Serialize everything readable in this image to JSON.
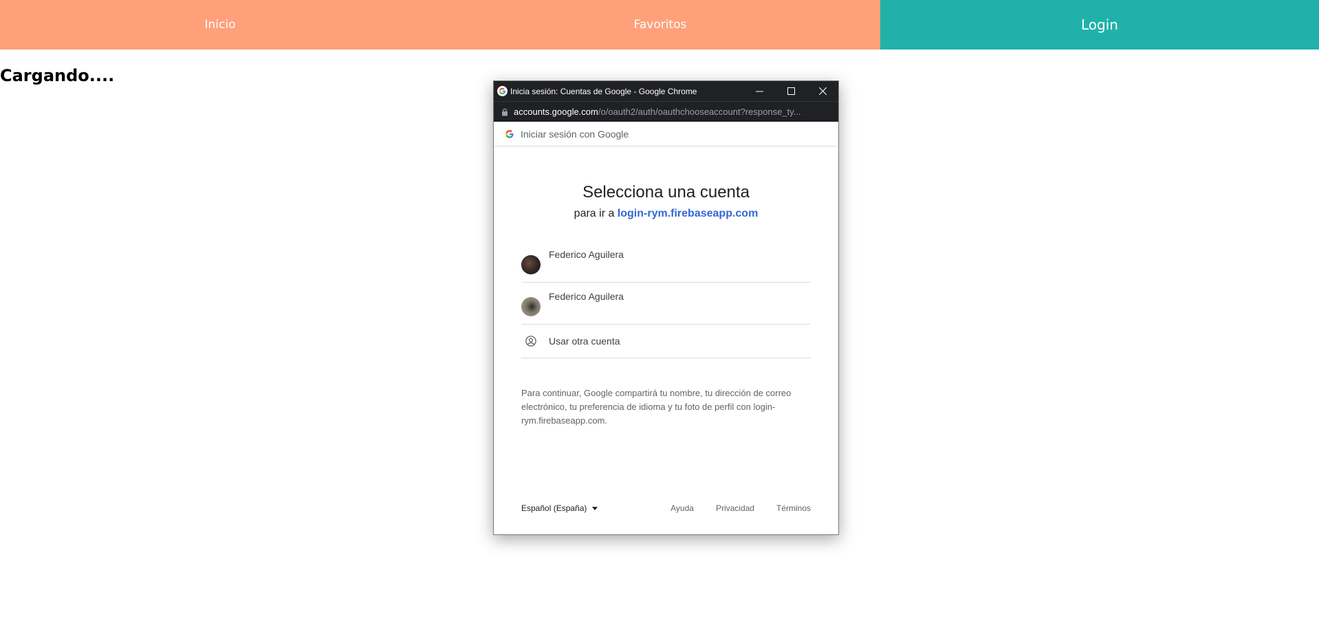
{
  "nav": {
    "items": [
      {
        "label": "Inicio"
      },
      {
        "label": "Favoritos"
      },
      {
        "label": "Login"
      }
    ]
  },
  "main": {
    "loading_text": "Cargando...."
  },
  "popup": {
    "window_title": "Inicia sesión: Cuentas de Google - Google Chrome",
    "url_host": "accounts.google.com",
    "url_path": "/o/oauth2/auth/oauthchooseaccount?response_ty...",
    "signin_header": "Iniciar sesión con Google",
    "heading": "Selecciona una cuenta",
    "subheading_prefix": "para ir a ",
    "subheading_link": "login-rym.firebaseapp.com",
    "accounts": [
      {
        "name": "Federico Aguilera"
      },
      {
        "name": "Federico Aguilera"
      }
    ],
    "other_account_label": "Usar otra cuenta",
    "disclaimer": "Para continuar, Google compartirá tu nombre, tu dirección de correo electrónico, tu preferencia de idioma y tu foto de perfil con login-rym.firebaseapp.com.",
    "footer": {
      "language": "Español (España)",
      "links": [
        "Ayuda",
        "Privacidad",
        "Términos"
      ]
    }
  },
  "colors": {
    "nav_coral": "#ffa07a",
    "nav_teal": "#20b2aa",
    "chrome_dark": "#202124",
    "link_blue": "#3367d6"
  },
  "icons": [
    "google-favicon",
    "minimize-icon",
    "maximize-icon",
    "close-icon",
    "lock-icon",
    "google-logo-icon",
    "user-circle-icon",
    "caret-down-icon"
  ]
}
